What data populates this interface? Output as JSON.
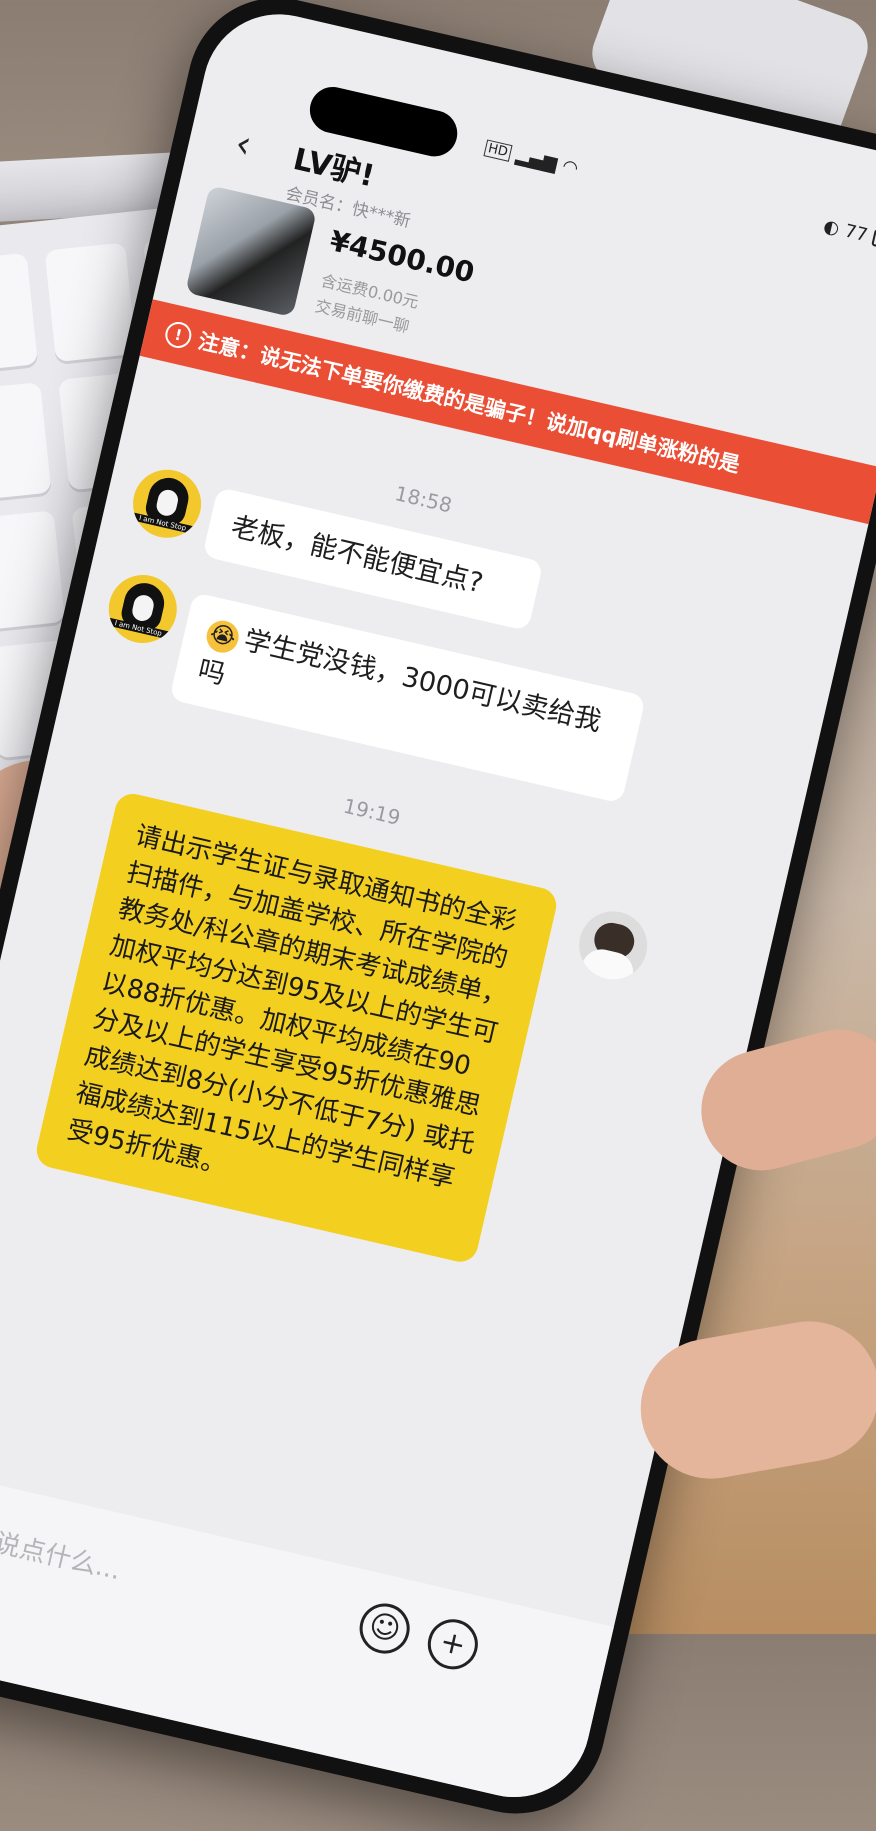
{
  "status_bar": {
    "network_label": "HD",
    "battery_text": "77"
  },
  "header": {
    "back_icon": "‹",
    "title": "LV驴!",
    "seller_name": "会员名：快***新"
  },
  "product": {
    "price": "¥4500.00",
    "shipping": "含运费0.00元",
    "tradeinfo": "交易前聊一聊"
  },
  "warning": {
    "icon": "!",
    "text": "注意：说无法下单要你缴费的是骗子！说加qq刷单涨粉的是"
  },
  "messages": [
    {
      "time": "18:58",
      "sender": "other",
      "text": "老板，能不能便宜点?"
    },
    {
      "sender": "other",
      "emoji": "😭",
      "text": "学生党没钱，3000可以卖给我吗"
    },
    {
      "time": "19:19",
      "sender": "me",
      "text": "请出示学生证与录取通知书的全彩扫描件，与加盖学校、所在学院的教务处/科公章的期末考试成绩单，加权平均分达到95及以上的学生可以88折优惠。加权平均成绩在90分及以上的学生享受95折优惠雅思成绩达到8分(小分不低于7分) 或托福成绩达到115以上的学生同样享受95折优惠。"
    }
  ],
  "input": {
    "placeholder": "想跟TA说点什么..."
  },
  "buttons": {
    "emoji": "☺",
    "plus": "+"
  },
  "avatar_caption": "I am Not Stop",
  "colors": {
    "warning_bg": "#ea4f36",
    "my_bubble": "#f3cf1f",
    "screen_bg": "#ededf0"
  }
}
